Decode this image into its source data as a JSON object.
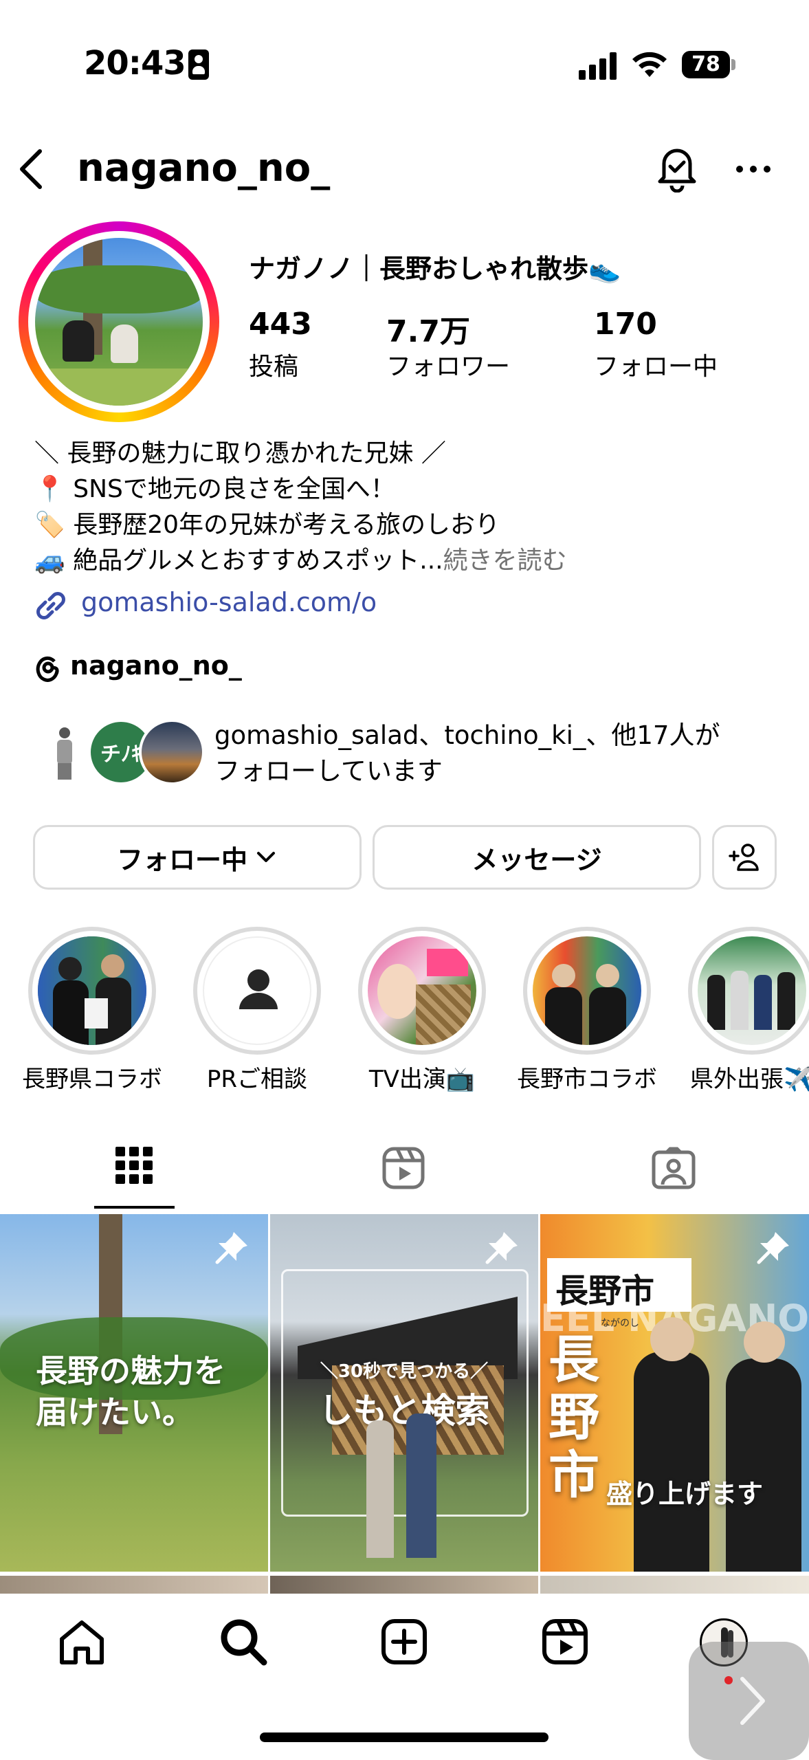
{
  "status_bar": {
    "time": "20:43",
    "battery": "78"
  },
  "header": {
    "username": "nagano_no_",
    "icons": [
      "back-arrow-icon",
      "notification-bell-icon",
      "more-options-icon"
    ]
  },
  "profile": {
    "display_name": "ナガノノ｜長野おしゃれ散歩👟",
    "stats": [
      {
        "value": "443",
        "label": "投稿"
      },
      {
        "value": "7.7万",
        "label": "フォロワー"
      },
      {
        "value": "170",
        "label": "フォロー中"
      }
    ],
    "bio": [
      "＼ 長野の魅力に取り憑かれた兄妹 ／",
      "📍 SNSで地元の良さを全国へ！",
      "🏷️ 長野歴20年の兄妹が考える旅のしおり",
      "🚙 絶品グルメとおすすめスポット..."
    ],
    "read_more": "続きを読む",
    "link": "gomashio-salad.com/o",
    "threads_handle": "nagano_no_",
    "followed_by_line1": "gomashio_salad、tochino_ki_、他17人が",
    "followed_by_line2": "フォローしています"
  },
  "buttons": {
    "following": "フォロー中",
    "message": "メッセージ"
  },
  "highlights": [
    {
      "label": "長野県コラボ"
    },
    {
      "label": "PRご相談"
    },
    {
      "label": "TV出演📺"
    },
    {
      "label": "長野市コラボ"
    },
    {
      "label": "県外出張✈️"
    }
  ],
  "tabs": [
    "grid-icon",
    "reels-icon",
    "tagged-icon"
  ],
  "posts": [
    {
      "caption_line1": "長野の魅力を",
      "caption_line2": "届けたい。"
    },
    {
      "caption_small": "＼30秒で見つかる／",
      "caption_big": "しもと検索"
    },
    {
      "badge": "長野市",
      "badge_sub": "ながのし",
      "big_vertical": "長野市",
      "caption_big": "盛り上げます",
      "backdrop": "EEL NAGANO BE NATURE"
    }
  ],
  "colors": {
    "link": "#3b4ea8",
    "border": "#dbdbdb",
    "muted": "#737373",
    "story_gradient": [
      "#d300c5",
      "#ff0069",
      "#ff7a00",
      "#ffd600"
    ]
  }
}
